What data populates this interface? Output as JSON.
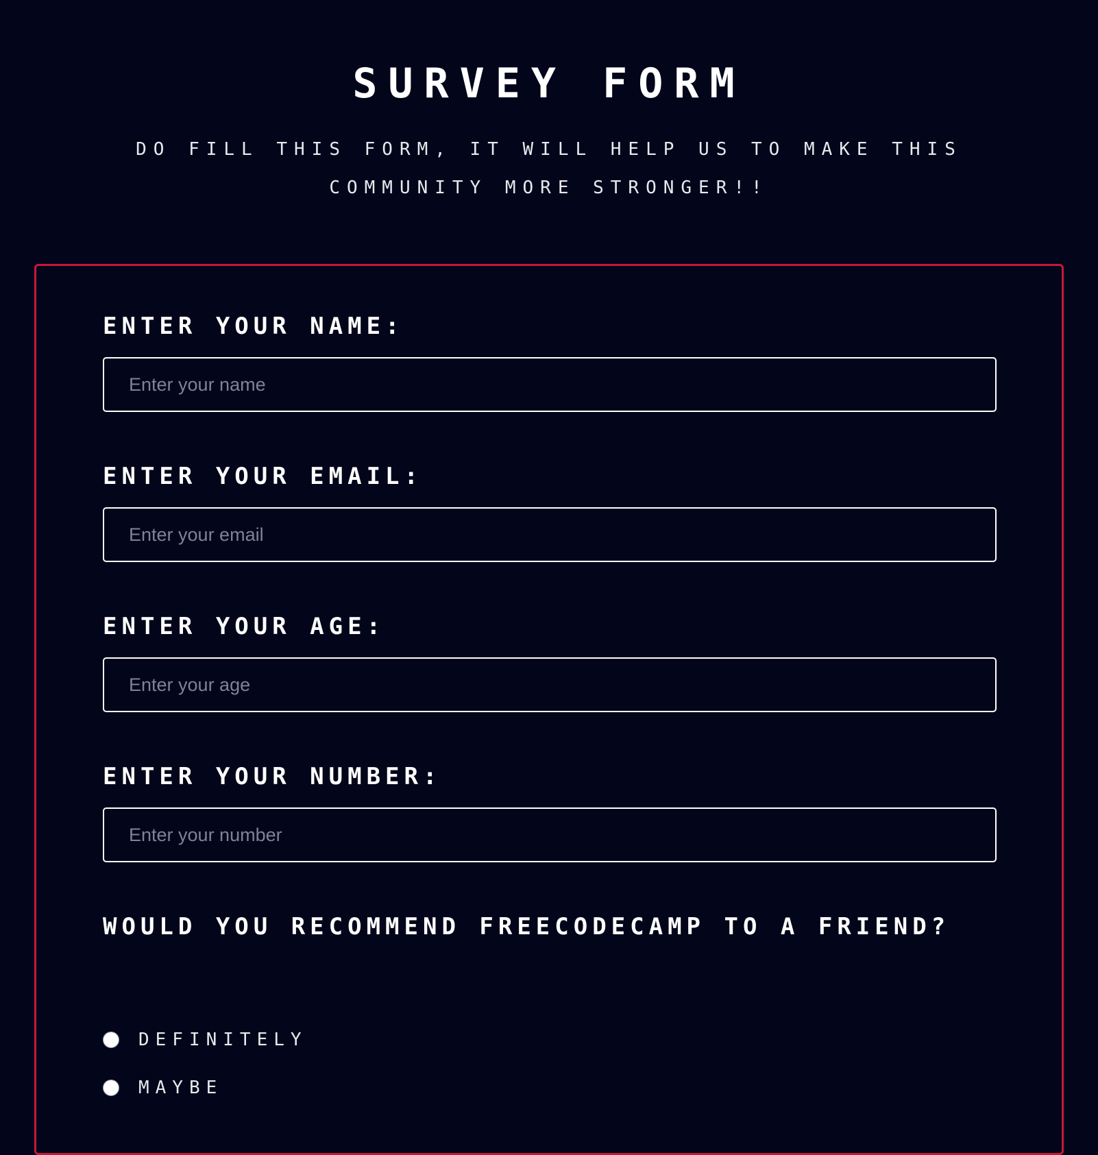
{
  "header": {
    "title": "Survey Form",
    "description": "Do fill this form, it will help us to make this community more stronger!!"
  },
  "form": {
    "fields": [
      {
        "label": "Enter your name:",
        "placeholder": "Enter your name",
        "value": ""
      },
      {
        "label": "Enter your email:",
        "placeholder": "Enter your email",
        "value": ""
      },
      {
        "label": "Enter your age:",
        "placeholder": "Enter your age",
        "value": ""
      },
      {
        "label": "Enter your number:",
        "placeholder": "Enter your number",
        "value": ""
      }
    ],
    "recommend": {
      "question": "Would you recommend freeCodeCamp to a friend?",
      "options": [
        {
          "label": "Definitely",
          "selected": false
        },
        {
          "label": "Maybe",
          "selected": false
        }
      ]
    }
  },
  "colors": {
    "background": "#03061a",
    "text": "#ffffff",
    "form_border": "#c8173b",
    "placeholder": "#7d8496"
  }
}
